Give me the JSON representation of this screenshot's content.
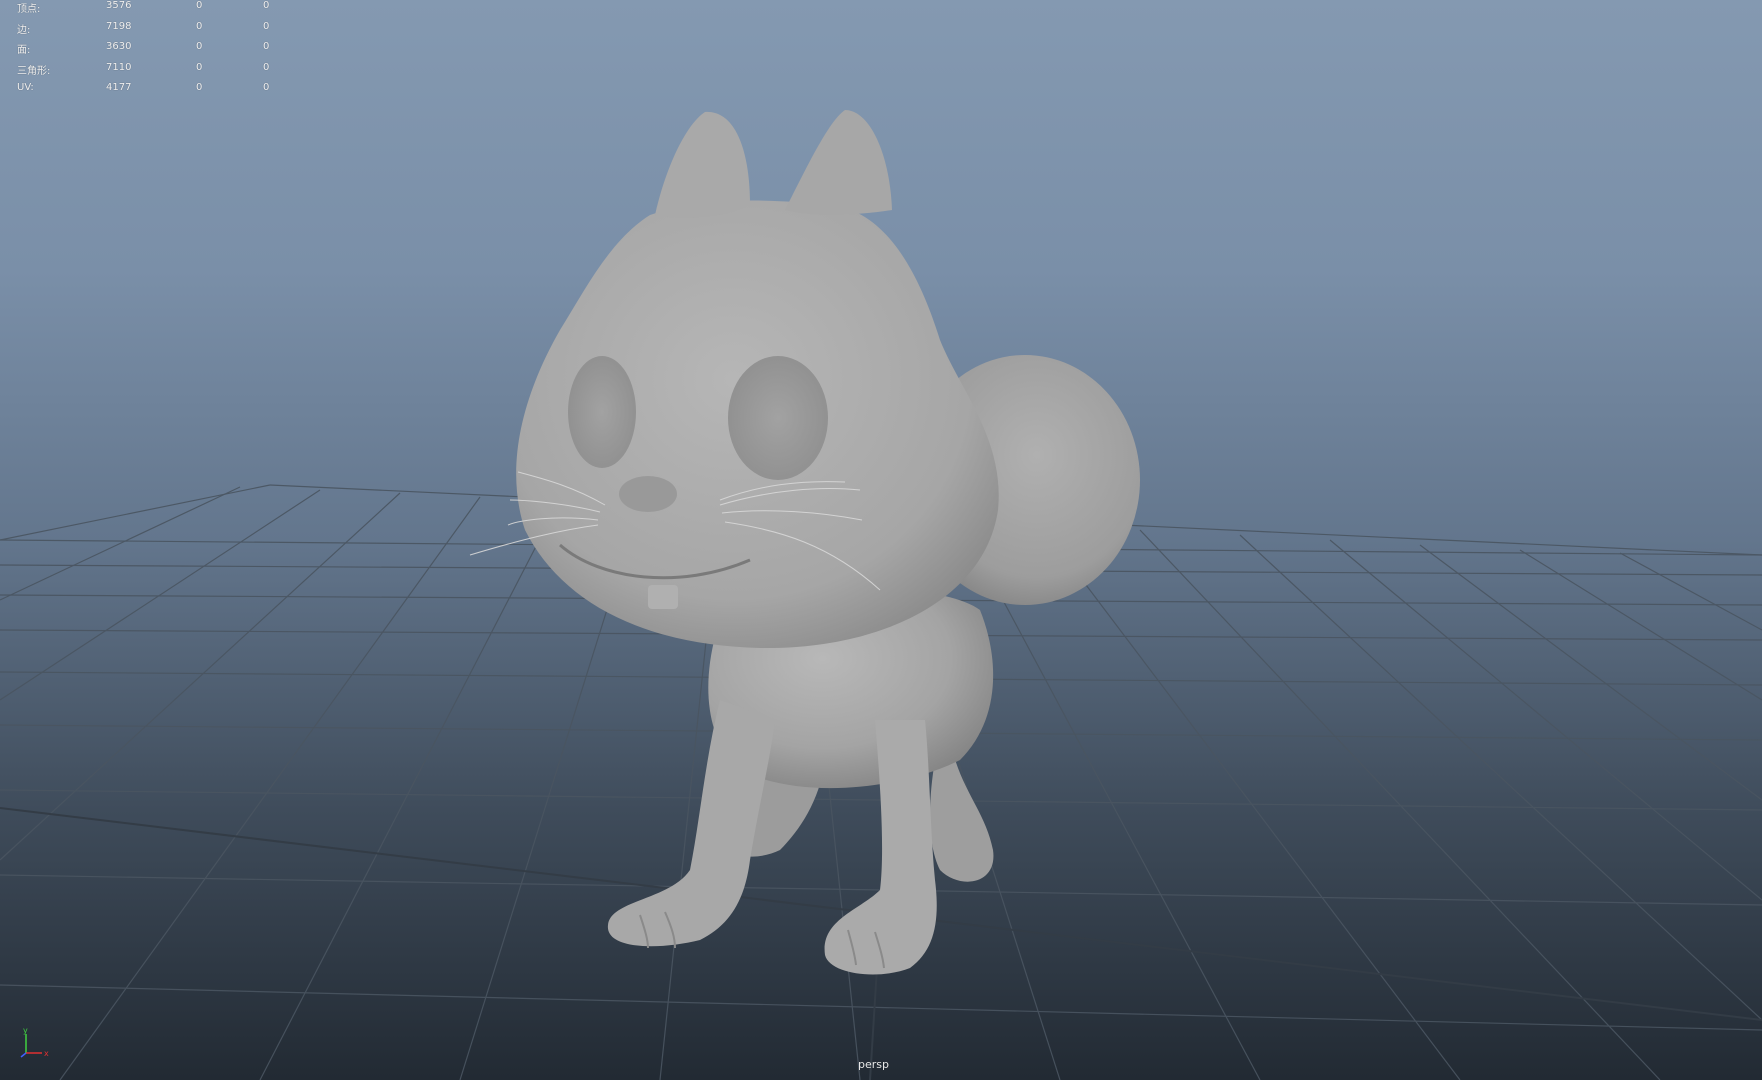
{
  "hud": {
    "rows": [
      {
        "label": "顶点:",
        "total": "3576",
        "selected": "0",
        "selected2": "0"
      },
      {
        "label": "边:",
        "total": "7198",
        "selected": "0",
        "selected2": "0"
      },
      {
        "label": "面:",
        "total": "3630",
        "selected": "0",
        "selected2": "0"
      },
      {
        "label": "三角形:",
        "total": "7110",
        "selected": "0",
        "selected2": "0"
      },
      {
        "label": "UV:",
        "total": "4177",
        "selected": "0",
        "selected2": "0"
      }
    ]
  },
  "viewport": {
    "camera": "persp",
    "background_top": "#8499b1",
    "background_bottom": "#222a33",
    "grid_color": "#4a5561",
    "model_color": "#a9a9a9"
  },
  "axis_gizmo": {
    "x_label": "x",
    "y_label": "y",
    "x_color": "#e03030",
    "y_color": "#40d040",
    "z_color": "#4060ff"
  }
}
